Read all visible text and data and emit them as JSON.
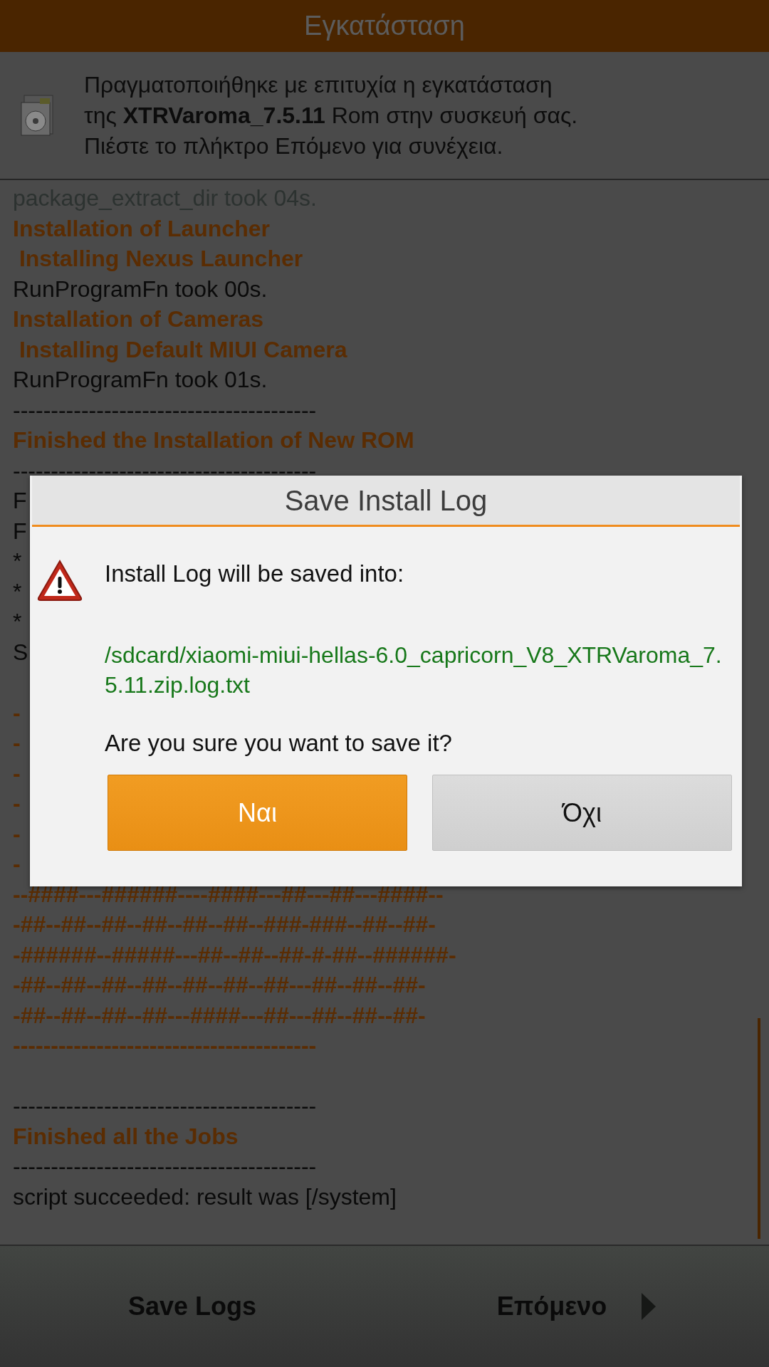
{
  "header": {
    "title": "Εγκατάσταση"
  },
  "message": {
    "lines": [
      "Πραγματοποιήθηκε με επιτυχία η εγκατάσταση",
      "της **XTRVaroma_7.5.11** Rom στην συσκευή σας.",
      "Πιέστε το πλήκτρο Επόμενο για συνέχεια."
    ]
  },
  "log": {
    "lines": [
      {
        "kind": "faded",
        "text": "package_extract_dir took 04s."
      },
      {
        "kind": "heading",
        "text": "Installation of Launcher"
      },
      {
        "kind": "heading",
        "text": " Installing Nexus Launcher"
      },
      {
        "kind": "plain",
        "text": "RunProgramFn took 00s."
      },
      {
        "kind": "heading",
        "text": "Installation of Cameras"
      },
      {
        "kind": "heading",
        "text": " Installing Default MIUI Camera"
      },
      {
        "kind": "plain",
        "text": "RunProgramFn took 01s."
      },
      {
        "kind": "plain",
        "text": "----------------------------------------"
      },
      {
        "kind": "heading",
        "text": "Finished the Installation of New ROM"
      },
      {
        "kind": "plain",
        "text": "----------------------------------------"
      },
      {
        "kind": "plain",
        "text": "F"
      },
      {
        "kind": "plain",
        "text": "F"
      },
      {
        "kind": "plain",
        "text": "*"
      },
      {
        "kind": "plain",
        "text": "*"
      },
      {
        "kind": "plain",
        "text": "*"
      },
      {
        "kind": "plain",
        "text": "S"
      },
      {
        "kind": "blank"
      },
      {
        "kind": "art",
        "text": "-"
      },
      {
        "kind": "art",
        "text": "-"
      },
      {
        "kind": "art",
        "text": "-"
      },
      {
        "kind": "art",
        "text": "-"
      },
      {
        "kind": "art",
        "text": "-"
      },
      {
        "kind": "art",
        "text": "-"
      },
      {
        "kind": "art",
        "text": "--####---######----####---##---##---####--"
      },
      {
        "kind": "art",
        "text": "-##--##--##--##--##--##--###-###--##--##-"
      },
      {
        "kind": "art",
        "text": "-######--#####---##--##--##-#-##--######-"
      },
      {
        "kind": "art",
        "text": "-##--##--##--##--##--##--##---##--##--##-"
      },
      {
        "kind": "art",
        "text": "-##--##--##--##---####---##---##--##--##-"
      },
      {
        "kind": "art",
        "text": "----------------------------------------"
      },
      {
        "kind": "blank"
      },
      {
        "kind": "plain",
        "text": "----------------------------------------"
      },
      {
        "kind": "heading",
        "text": "Finished all the Jobs"
      },
      {
        "kind": "plain",
        "text": "----------------------------------------"
      },
      {
        "kind": "plain",
        "text": "script succeeded: result was [/system]"
      }
    ]
  },
  "dialog": {
    "title": "Save Install Log",
    "message": "Install Log will be saved into:",
    "path": "/sdcard/xiaomi-miui-hellas-6.0_capricorn_V8_XTRVaroma_7.5.11.zip.log.txt",
    "question": "Are you sure you want to save it?",
    "buttons": [
      {
        "label": "Ναι",
        "kind": "primary"
      },
      {
        "label": "Όχι",
        "kind": "secondary"
      }
    ]
  },
  "bottom_bar": {
    "buttons": [
      {
        "label": "Save Logs",
        "arrow": false
      },
      {
        "label": "Επόμενο",
        "arrow": true
      }
    ]
  }
}
